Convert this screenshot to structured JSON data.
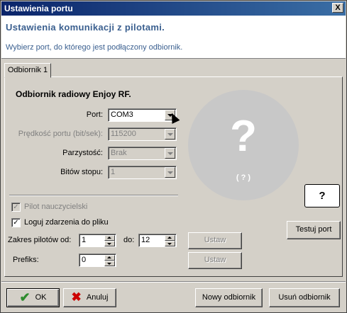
{
  "window": {
    "title": "Ustawienia portu",
    "close_glyph": "X"
  },
  "header": {
    "title": "Ustawienia komunikacji z pilotami.",
    "subtitle": "Wybierz port, do którego jest podłączony odbiornik."
  },
  "tabs": [
    {
      "label": "Odbiornik 1",
      "active": true
    }
  ],
  "receiver": {
    "title": "Odbiornik radiowy Enjoy RF.",
    "fields": {
      "port": {
        "label": "Port:",
        "value": "COM3",
        "enabled": true
      },
      "speed": {
        "label": "Prędkość portu (bit/sek):",
        "value": "115200",
        "enabled": false
      },
      "parity": {
        "label": "Parzystość:",
        "value": "Brak",
        "enabled": false
      },
      "stop_bits": {
        "label": "Bitów stopu:",
        "value": "1",
        "enabled": false
      }
    },
    "status_icon": {
      "symbol": "?",
      "caption": "( ? )"
    },
    "help_button": "?"
  },
  "options": {
    "teacher_remote": {
      "label": "Pilot nauczycielski",
      "checked": true,
      "enabled": false
    },
    "log_events": {
      "label": "Loguj zdarzenia do pliku",
      "checked": true,
      "enabled": true
    }
  },
  "range": {
    "label_from": "Zakres pilotów od:",
    "from_value": "1",
    "label_to": "do:",
    "to_value": "12",
    "set_label": "Ustaw"
  },
  "prefix": {
    "label": "Prefiks:",
    "value": "0",
    "set_label": "Ustaw"
  },
  "test_port_label": "Testuj port",
  "footer": {
    "ok_label": "OK",
    "cancel_label": "Anuluj",
    "new_receiver_label": "Nowy odbiornik",
    "remove_receiver_label": "Usuń odbiornik"
  },
  "colors": {
    "accent": "#3a5f8f",
    "titlebar": "#0a246a",
    "ok_check": "#2e8b2e",
    "cancel_x": "#cc0000",
    "status_circle": "#c8c8c8"
  }
}
